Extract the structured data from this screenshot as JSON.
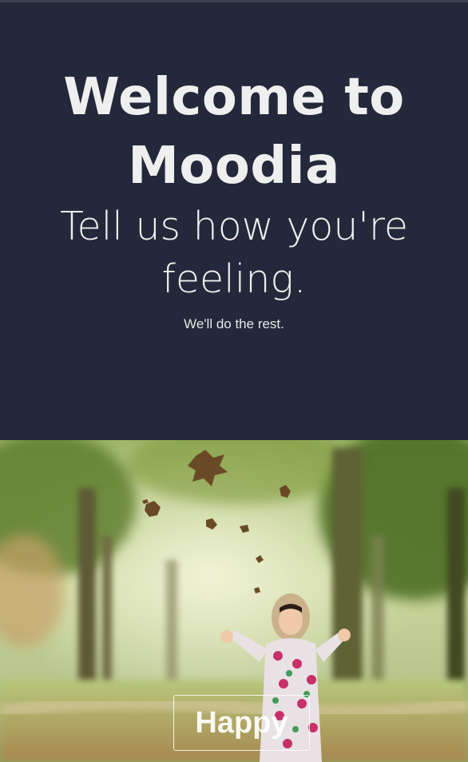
{
  "hero": {
    "title_line1": "Welcome to",
    "title_line2": "Moodia",
    "subtitle_line1": "Tell us how you're",
    "subtitle_line2": "feeling.",
    "tagline": "We'll do the rest."
  },
  "mood": {
    "button_label": "Happy"
  },
  "colors": {
    "hero_background": "#23283a",
    "hero_text": "#efefef"
  },
  "icons": {
    "photo": "child-throwing-leaves-photo"
  }
}
